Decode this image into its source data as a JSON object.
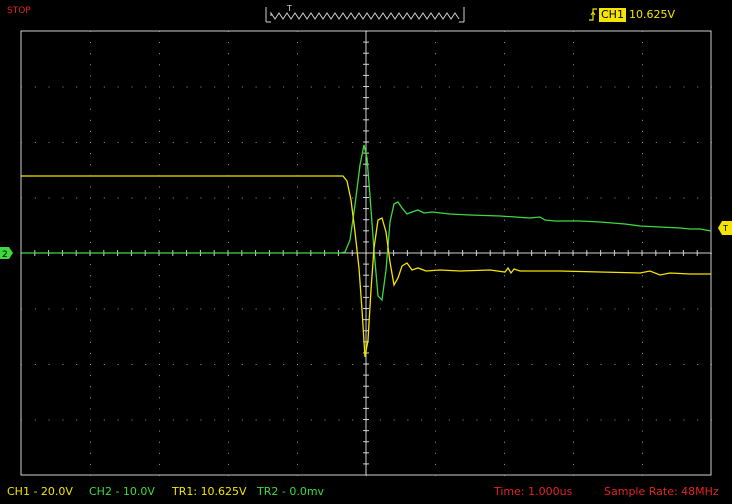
{
  "status": {
    "run_state": "STOP"
  },
  "timebase": {
    "trigger_marker": "T"
  },
  "trigger": {
    "source": "CH1",
    "level": "10.625V"
  },
  "markers": {
    "ch2_ground": "2",
    "trigger_level_glyph": "T"
  },
  "bottom": {
    "ch1_scale": "CH1 - 20.0V",
    "ch2_scale": "CH2 - 10.0V",
    "tr1": "TR1: 10.625V",
    "tr2": "TR2 - 0.0mv",
    "time": "Time: 1.000us",
    "sample_rate": "Sample Rate: 48MHz"
  },
  "colors": {
    "ch1": "#f4e400",
    "ch2": "#3ed93e",
    "alert": "#e02424",
    "grid_dots": "#9a9a9a",
    "frame": "#d0d0d0"
  }
}
